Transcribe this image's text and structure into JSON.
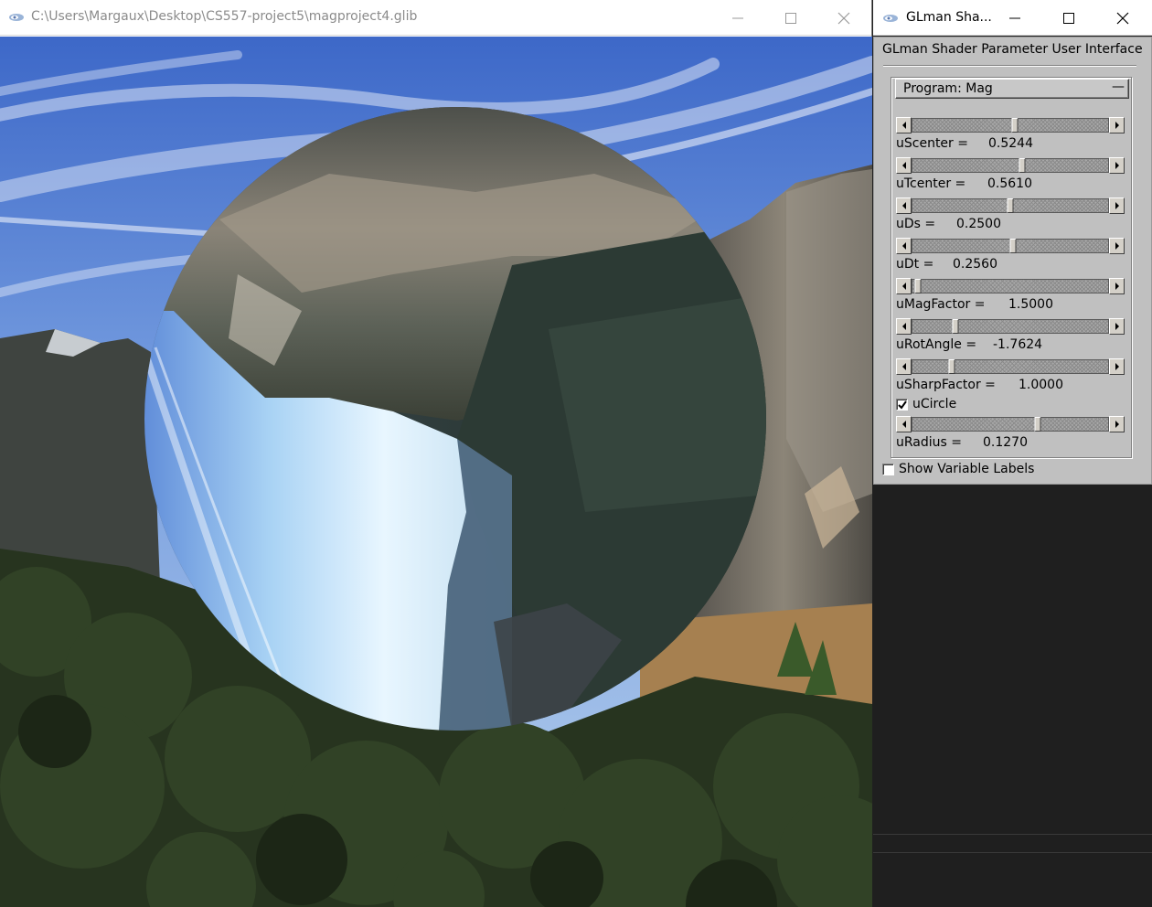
{
  "main_window": {
    "title": "C:\\Users\\Margaux\\Desktop\\CS557-project5\\magproject4.glib",
    "scene": {
      "description_icon": "glman-render-viewport",
      "lens_circle": "magnified-rotated-region"
    }
  },
  "glman_window": {
    "title": "GLman Sha...",
    "heading": "GLman Shader Parameter User Interface",
    "program_label": "Program: Mag",
    "collapse_symbol": "—",
    "parameters": [
      {
        "name": "uScenter =",
        "value": "0.5244",
        "fraction": 0.5244
      },
      {
        "name": "uTcenter =",
        "value": "0.5610",
        "fraction": 0.561
      },
      {
        "name": "uDs =",
        "value": "0.2500",
        "fraction": 0.5
      },
      {
        "name": "uDt =",
        "value": "0.2560",
        "fraction": 0.512
      },
      {
        "name": "uMagFactor =",
        "value": "1.5000",
        "fraction": 0.03
      },
      {
        "name": "uRotAngle =",
        "value": "-1.7624",
        "fraction": 0.22
      },
      {
        "name": "uSharpFactor =",
        "value": "1.0000",
        "fraction": 0.2
      }
    ],
    "ucircle_label": "uCircle",
    "ucircle_checked": true,
    "radius_param": {
      "name": "uRadius =",
      "value": "0.1270",
      "fraction": 0.64
    },
    "show_labels": "Show Variable Labels",
    "show_labels_checked": false
  },
  "colors": {
    "panel_bg": "#c0c0c0",
    "dark_bg": "#1f1f1f",
    "sky_top": "#3a64c8",
    "sky_bottom": "#9dc4f0"
  },
  "icons": [
    "glman-logo-icon",
    "minimize-icon",
    "maximize-icon",
    "close-icon",
    "arrow-left-icon",
    "arrow-right-icon",
    "checkmark-icon"
  ]
}
